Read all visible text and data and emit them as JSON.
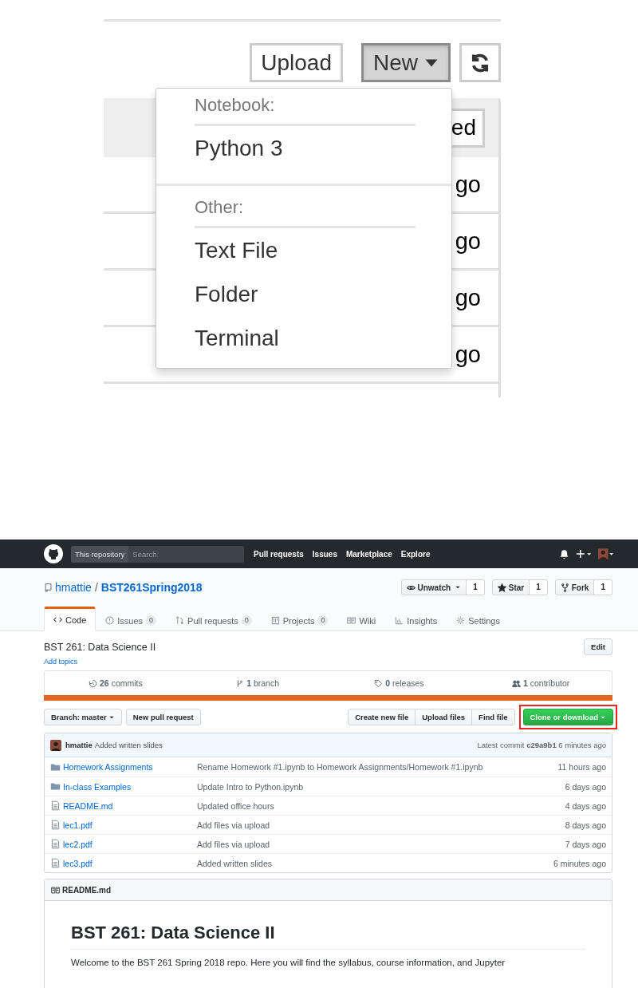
{
  "jupyter": {
    "toolbar": {
      "buttons": [
        {
          "kind": "text",
          "label": "Upload",
          "active": false
        },
        {
          "kind": "dropdown",
          "label": "New",
          "active": true
        },
        {
          "kind": "refresh",
          "active": false
        }
      ]
    },
    "list": {
      "header_button": "ed",
      "rows": [
        {
          "column_3": "go"
        },
        {
          "column_3": "go"
        },
        {
          "column_3": "go"
        },
        {
          "column_3": "go"
        }
      ]
    },
    "new_menu": {
      "sections": [
        {
          "header": "Notebook:",
          "items": [
            "Python 3"
          ]
        },
        {
          "header": "Other:",
          "items": [
            "Text File",
            "Folder",
            "Terminal"
          ]
        }
      ]
    }
  },
  "github": {
    "nav": {
      "scope": "This repository",
      "search_placeholder": "Search",
      "links": [
        "Pull requests",
        "Issues",
        "Marketplace",
        "Explore"
      ]
    },
    "repo": {
      "owner": "hmattie",
      "separator": "/",
      "name": "BST261Spring2018"
    },
    "actions": [
      {
        "label": "Unwatch",
        "count": "1"
      },
      {
        "label": "Star",
        "count": "1"
      },
      {
        "label": "Fork",
        "count": "1"
      }
    ],
    "tabs": [
      {
        "label": "Code",
        "selected": true
      },
      {
        "label": "Issues",
        "count": "0",
        "selected": false
      },
      {
        "label": "Pull requests",
        "count": "0",
        "selected": false
      },
      {
        "label": "Projects",
        "count": "0",
        "selected": false
      },
      {
        "label": "Wiki",
        "selected": false
      },
      {
        "label": "Insights",
        "selected": false
      },
      {
        "label": "Settings",
        "selected": false
      }
    ],
    "description": "BST 261: Data Science II",
    "edit": "Edit",
    "add_topics": "Add topics",
    "stats": [
      "**26** commits",
      "**1** branch",
      "**0** releases",
      "**1** contributor"
    ],
    "branch_button": "Branch: **master**",
    "new_pull_request": "New pull request",
    "file_buttons": [
      "Create new file",
      "Upload files",
      "Find file"
    ],
    "clone": {
      "label": "Clone or download",
      "highlighted": true
    },
    "commit": {
      "author": "hmattie",
      "message": "Added written slides",
      "latest": "Latest commit **c29a9b1** 6 minutes ago"
    },
    "files": [
      {
        "kind": "folder",
        "name": "Homework Assignments",
        "message": "Rename Homework #1.ipynb to Homework Assignments/Homework #1.ipynb",
        "age": "11 hours ago"
      },
      {
        "kind": "folder",
        "name": "In-class Examples",
        "message": "Update Intro to Python.ipynb",
        "age": "6 days ago"
      },
      {
        "kind": "file",
        "name": "README.md",
        "message": "Updated office hours",
        "age": "4 days ago"
      },
      {
        "kind": "file",
        "name": "lec1.pdf",
        "message": "Add files via upload",
        "age": "8 days ago"
      },
      {
        "kind": "file",
        "name": "lec2.pdf",
        "message": "Add files via upload",
        "age": "7 days ago"
      },
      {
        "kind": "file",
        "name": "lec3.pdf",
        "message": "Added written slides",
        "age": "6 minutes ago"
      }
    ],
    "readme": {
      "title": "README.md",
      "heading": "BST 261: Data Science II",
      "text": "Welcome to the BST 261 Spring 2018 repo. Here you will find the syllabus, course information, and Jupyter"
    }
  }
}
